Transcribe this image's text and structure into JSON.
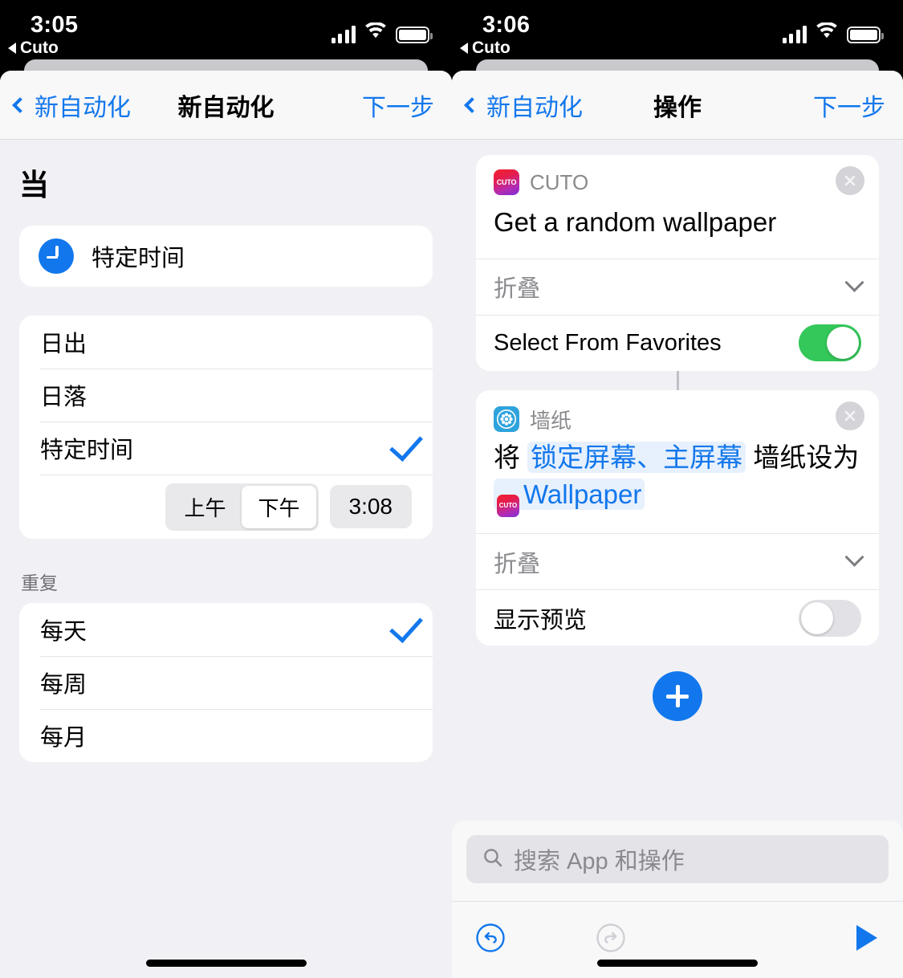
{
  "left": {
    "status": {
      "time": "3:05",
      "back_app": "Cuto",
      "signal_icon": "cellular-bars-icon",
      "wifi_icon": "wifi-icon",
      "battery_icon": "battery-full-icon"
    },
    "nav": {
      "back_label": "新自动化",
      "title": "新自动化",
      "next_label": "下一步"
    },
    "heading": "当",
    "trigger_card": {
      "icon": "clock-icon",
      "label": "特定时间"
    },
    "trigger_options": [
      {
        "label": "日出",
        "selected": false
      },
      {
        "label": "日落",
        "selected": false
      },
      {
        "label": "特定时间",
        "selected": true
      }
    ],
    "time_picker": {
      "am_label": "上午",
      "pm_label": "下午",
      "selected_meridiem": "下午",
      "time_value": "3:08"
    },
    "repeat_section_label": "重复",
    "repeat_options": [
      {
        "label": "每天",
        "selected": true
      },
      {
        "label": "每周",
        "selected": false
      },
      {
        "label": "每月",
        "selected": false
      }
    ]
  },
  "right": {
    "status": {
      "time": "3:06",
      "back_app": "Cuto",
      "signal_icon": "cellular-bars-icon",
      "wifi_icon": "wifi-icon",
      "battery_icon": "battery-full-icon"
    },
    "nav": {
      "back_label": "新自动化",
      "title": "操作",
      "next_label": "下一步"
    },
    "action_cards": [
      {
        "app_name": "CUTO",
        "app_icon": "cuto-app-icon",
        "icon_text": "CUTO",
        "title": "Get a random wallpaper",
        "collapse_label": "折叠",
        "param_label": "Select From Favorites",
        "param_toggle_on": true
      },
      {
        "app_name": "墙纸",
        "app_icon": "wallpaper-app-icon",
        "title_prefix": "将",
        "title_token1": "锁定屏幕、主屏幕",
        "title_middle": "墙纸设为",
        "title_token2": "Wallpaper",
        "token2_icon_text": "CUTO",
        "collapse_label": "折叠",
        "param_label": "显示预览",
        "param_toggle_on": false
      }
    ],
    "add_button": "add-action-button",
    "search": {
      "placeholder": "搜索 App 和操作",
      "icon": "search-icon"
    },
    "toolbar": {
      "undo_icon": "undo-icon",
      "redo_icon": "redo-icon",
      "play_icon": "play-icon",
      "undo_enabled": true,
      "redo_enabled": false
    }
  },
  "colors": {
    "accent_blue": "#1277ec",
    "toggle_green": "#34c759",
    "background_gray": "#f1f1f5",
    "card_white": "#ffffff",
    "muted_text": "#8a8a8e",
    "token_blue_bg": "#e7f0fd"
  }
}
